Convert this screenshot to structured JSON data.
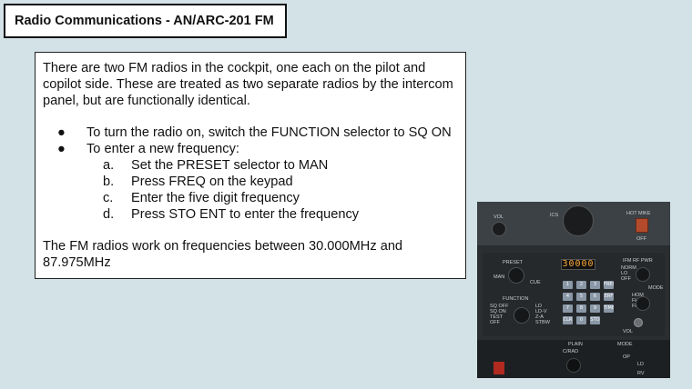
{
  "header": {
    "title": "Radio Communications - AN/ARC-201 FM"
  },
  "body": {
    "intro": "There are two FM radios in the cockpit, one each on the pilot and copilot side. These are treated as two separate radios by the intercom panel, but are functionally identical.",
    "bullets": [
      "To turn the radio on, switch the FUNCTION selector to SQ ON",
      "To enter a new frequency:"
    ],
    "steps": [
      {
        "mark": "a.",
        "text": "Set the PRESET selector to MAN"
      },
      {
        "mark": "b.",
        "text": "Press FREQ on the keypad"
      },
      {
        "mark": "c.",
        "text": "Enter the five digit frequency"
      },
      {
        "mark": "d.",
        "text": "Press STO ENT to enter the frequency"
      }
    ],
    "footer": "The FM radios work on frequencies between 30.000MHz and 87.975MHz"
  },
  "panel": {
    "display": "30000",
    "vol": "VOL",
    "ics": "ICS",
    "hot_mike": "HOT MIKE",
    "off": "OFF",
    "preset": "PRESET",
    "man": "MAN",
    "cue": "CUE",
    "function": "FUNCTION",
    "function_opts": "SQ OFF\nSQ ON\nTEST\nOFF",
    "function_opts_r": "LD\nLD-V\nZ-A\nSTBW",
    "ifm": "IFM RF PWR",
    "ifm_opts": "NORM\nLO\nOFF",
    "mode": "MODE",
    "mode_opts": "HOM\nFH\nFH-M",
    "vol2": "VOL",
    "plain": "PLAIN",
    "cnrad": "C/RAD",
    "mode2": "MODE",
    "op": "OP",
    "ld": "LD",
    "rv": "RV",
    "keys": [
      "1",
      "2",
      "3",
      "FREQ",
      "4",
      "5",
      "6",
      "ERF\nOFST",
      "7",
      "8",
      "9",
      "TIME",
      "CLR",
      "0",
      "STO\nENT"
    ],
    "colors": {
      "display_text": "#ffa83a",
      "keypad": "#8a97a6",
      "hotmike_switch": "#b34a2c"
    }
  }
}
